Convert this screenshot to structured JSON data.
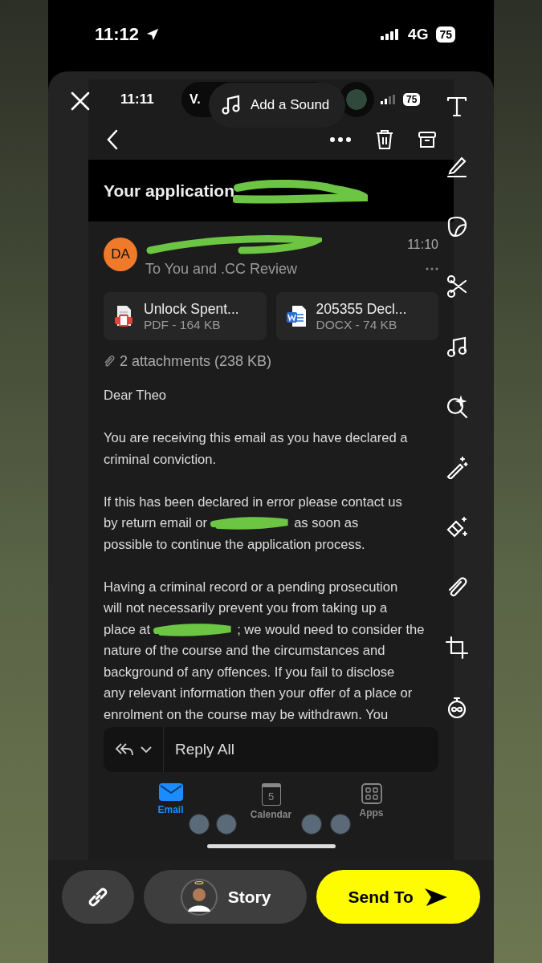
{
  "status_bar": {
    "time": "11:12",
    "network": "4G",
    "battery": "75"
  },
  "editor": {
    "sound_button": "Add a Sound"
  },
  "captured_screen": {
    "status_bar": {
      "time": "11:11",
      "app_badge": "V.",
      "battery": "75"
    },
    "subject": "Your application",
    "sender": {
      "initials": "DA",
      "time": "11:10",
      "recipients": "To You and .CC Review"
    },
    "attachments": [
      {
        "kind": "pdf",
        "name": "Unlock Spent...",
        "meta": "PDF - 164 KB"
      },
      {
        "kind": "word",
        "name": "205355 Decl...",
        "meta": "DOCX - 74 KB"
      }
    ],
    "attachments_summary": "2 attachments (238 KB)",
    "body": [
      {
        "lines": [
          [
            {
              "kind": "text",
              "text": "Dear Theo"
            }
          ]
        ]
      },
      {
        "lines": [
          [
            {
              "kind": "text",
              "text": "You are receiving this email as you have declared a"
            }
          ],
          [
            {
              "kind": "text",
              "text": "criminal conviction."
            }
          ]
        ]
      },
      {
        "lines": [
          [
            {
              "kind": "text",
              "text": "If this has been declared in error please contact us"
            }
          ],
          [
            {
              "kind": "text",
              "text": "by return email or"
            },
            {
              "kind": "redaction"
            },
            {
              "kind": "text",
              "text": "as soon as"
            }
          ],
          [
            {
              "kind": "text",
              "text": "possible to continue the application process."
            }
          ]
        ]
      },
      {
        "lines": [
          [
            {
              "kind": "text",
              "text": "Having a criminal record or a pending prosecution"
            }
          ],
          [
            {
              "kind": "text",
              "text": "will not necessarily prevent you from taking up a"
            }
          ],
          [
            {
              "kind": "text",
              "text": "place at"
            },
            {
              "kind": "redaction"
            },
            {
              "kind": "text",
              "text": "; we would need to consider the"
            }
          ],
          [
            {
              "kind": "text",
              "text": "nature of the course and the circumstances and"
            }
          ],
          [
            {
              "kind": "text",
              "text": "background of any offences. If you fail to disclose"
            }
          ],
          [
            {
              "kind": "text",
              "text": "any relevant information then your offer of a place or"
            }
          ],
          [
            {
              "kind": "text",
              "text": "enrolment on the course may be withdrawn. You"
            }
          ]
        ]
      }
    ],
    "reply_button": "Reply All",
    "nav": [
      {
        "kind": "email",
        "label": "Email",
        "selected": true
      },
      {
        "kind": "calendar",
        "label": "Calendar",
        "badge": "5",
        "selected": false
      },
      {
        "kind": "apps",
        "label": "Apps",
        "selected": false
      }
    ]
  },
  "bottom_bar": {
    "story_label": "Story",
    "send_label": "Send To"
  }
}
